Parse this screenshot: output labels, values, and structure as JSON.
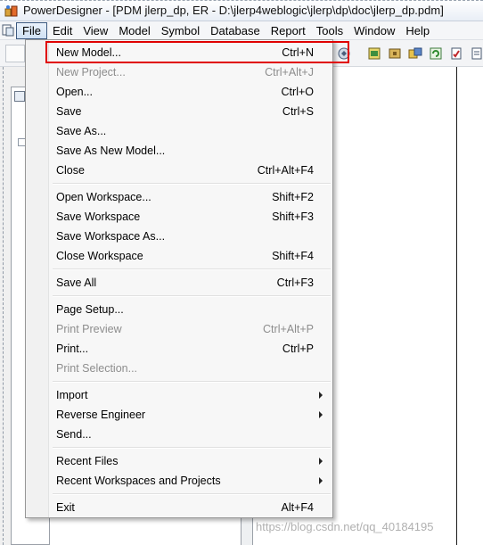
{
  "window": {
    "title": "PowerDesigner - [PDM jlerp_dp, ER - D:\\jlerp4weblogic\\jlerp\\dp\\doc\\jlerp_dp.pdm]"
  },
  "menubar": {
    "items": [
      "File",
      "Edit",
      "View",
      "Model",
      "Symbol",
      "Database",
      "Report",
      "Tools",
      "Window",
      "Help"
    ],
    "active": "File"
  },
  "file_menu": {
    "items": [
      {
        "label": "New Model...",
        "shortcut": "Ctrl+N",
        "enabled": true,
        "highlighted": true
      },
      {
        "label": "New Project...",
        "shortcut": "Ctrl+Alt+J",
        "enabled": false
      },
      {
        "label": "Open...",
        "shortcut": "Ctrl+O",
        "enabled": true
      },
      {
        "label": "Save",
        "shortcut": "Ctrl+S",
        "enabled": true
      },
      {
        "label": "Save As...",
        "shortcut": "",
        "enabled": true
      },
      {
        "label": "Save As New Model...",
        "shortcut": "",
        "enabled": true
      },
      {
        "label": "Close",
        "shortcut": "Ctrl+Alt+F4",
        "enabled": true
      },
      {
        "label": "Open Workspace...",
        "shortcut": "Shift+F2",
        "enabled": true
      },
      {
        "label": "Save Workspace",
        "shortcut": "Shift+F3",
        "enabled": true
      },
      {
        "label": "Save Workspace As...",
        "shortcut": "",
        "enabled": true
      },
      {
        "label": "Close Workspace",
        "shortcut": "Shift+F4",
        "enabled": true
      },
      {
        "label": "Save All",
        "shortcut": "Ctrl+F3",
        "enabled": true
      },
      {
        "label": "Page Setup...",
        "shortcut": "",
        "enabled": true
      },
      {
        "label": "Print Preview",
        "shortcut": "Ctrl+Alt+P",
        "enabled": false
      },
      {
        "label": "Print...",
        "shortcut": "Ctrl+P",
        "enabled": true
      },
      {
        "label": "Print Selection...",
        "shortcut": "",
        "enabled": false
      },
      {
        "label": "Import",
        "shortcut": "",
        "enabled": true,
        "submenu": true
      },
      {
        "label": "Reverse Engineer",
        "shortcut": "",
        "enabled": true,
        "submenu": true
      },
      {
        "label": "Send...",
        "shortcut": "",
        "enabled": true
      },
      {
        "label": "Recent Files",
        "shortcut": "",
        "enabled": true,
        "submenu": true
      },
      {
        "label": "Recent Workspaces and Projects",
        "shortcut": "",
        "enabled": true,
        "submenu": true
      },
      {
        "label": "Exit",
        "shortcut": "Alt+F4",
        "enabled": true
      }
    ]
  },
  "watermark": "https://blog.csdn.net/qq_40184195",
  "colors": {
    "highlight_border": "#e00000",
    "disabled_text": "#8d8d8d",
    "menu_active_border": "#3d5a80"
  }
}
